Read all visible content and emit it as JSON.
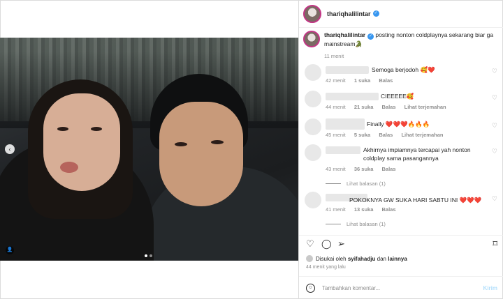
{
  "post": {
    "username": "thariqhalilintar",
    "caption_user": "thariqhalilintar",
    "caption_text": "posting nonton coldplaynya sekarang biar ga mainstream🐊",
    "caption_time": "11 menit"
  },
  "comments": [
    {
      "text": "Semoga berjodoh 🥰❤️",
      "time": "42 menit",
      "likes": "1 suka",
      "reply": "Balas",
      "translate": ""
    },
    {
      "text": "CIEEEEE🥰",
      "time": "44 menit",
      "likes": "21 suka",
      "reply": "Balas",
      "translate": "Lihat terjemahan"
    },
    {
      "text": "Finally ❤️❤️❤️🔥🔥🔥",
      "time": "45 menit",
      "likes": "5 suka",
      "reply": "Balas",
      "translate": "Lihat terjemahan"
    },
    {
      "text": "Akhirnya impiamnya tercapai yah nonton coldplay sama pasangannya",
      "time": "43 menit",
      "likes": "36 suka",
      "reply": "Balas",
      "translate": "",
      "view_replies": "Lihat balasan (1)"
    },
    {
      "text": "POKOKNYA GW SUKA HARI SABTU INI ❤️❤️❤️",
      "time": "41 menit",
      "likes": "13 suka",
      "reply": "Balas",
      "translate": "",
      "view_replies": "Lihat balasan (1)"
    }
  ],
  "likes": {
    "prefix": "Disukai oleh",
    "user": "syifahadju",
    "connector": "dan",
    "others": "lainnya"
  },
  "post_time": "44 menit yang lalu",
  "add_comment": {
    "placeholder": "Tambahkan komentar...",
    "post_label": "Kirim"
  },
  "icons": {
    "like": "heart-icon",
    "comment": "comment-icon",
    "share": "send-icon",
    "save": "bookmark-icon",
    "emoji": "emoji-icon",
    "verified": "verified-badge-icon",
    "prev": "chevron-left-icon",
    "tag": "user-tag-icon"
  },
  "colors": {
    "verified": "#3897f0",
    "muted": "#8e8e8e",
    "post_button": "#b2dffc"
  }
}
